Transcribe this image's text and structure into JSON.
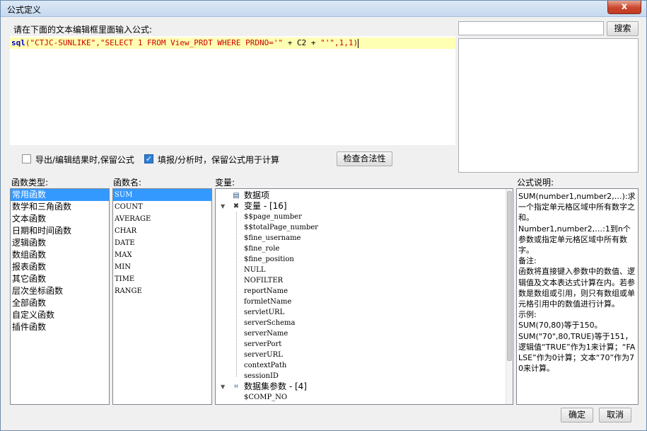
{
  "window": {
    "title": "公式定义",
    "close_label": "x"
  },
  "editor": {
    "label": "请在下面的文本编辑框里面输入公式:",
    "tokens": [
      {
        "text": "sql",
        "kind": "fn"
      },
      {
        "text": "(\"CTJC-SUNLIKE\",\"SELECT 1 FROM View_PRDT WHERE PRDNO='\"",
        "kind": "str"
      },
      {
        "text": " + C2 + ",
        "kind": "plain"
      },
      {
        "text": "\"'\"",
        "kind": "str"
      },
      {
        "text": ",1,1)",
        "kind": "str"
      }
    ]
  },
  "search": {
    "value": "",
    "button_label": "搜索"
  },
  "options": {
    "export_keep": {
      "label": "导出/编辑结果时,保留公式",
      "checked": false
    },
    "fill_keep": {
      "label": "填报/分析时，保留公式用于计算",
      "checked": true
    },
    "check_button": "检查合法性"
  },
  "function_types": {
    "label": "函数类型:",
    "items": [
      "常用函数",
      "数学和三角函数",
      "文本函数",
      "日期和时间函数",
      "逻辑函数",
      "数组函数",
      "报表函数",
      "其它函数",
      "层次坐标函数",
      "全部函数",
      "自定义函数",
      "插件函数"
    ],
    "selected": 0
  },
  "function_names": {
    "label": "函数名:",
    "items": [
      "SUM",
      "COUNT",
      "AVERAGE",
      "CHAR",
      "DATE",
      "MAX",
      "MIN",
      "TIME",
      "RANGE"
    ],
    "selected": 0
  },
  "variables": {
    "label": "变量:",
    "root_data_items": "数据项",
    "group_variables": "变量 - [16]",
    "variable_items": [
      "$$page_number",
      "$$totalPage_number",
      "$fine_username",
      "$fine_role",
      "$fine_position",
      "NULL",
      "NOFILTER",
      "reportName",
      "formletName",
      "servletURL",
      "serverSchema",
      "serverName",
      "serverPort",
      "serverURL",
      "contextPath",
      "sessionID"
    ],
    "group_dataset": "数据集参数 - [4]",
    "dataset_items": [
      "$COMP_NO"
    ]
  },
  "description": {
    "label": "公式说明:",
    "paragraphs": [
      "SUM(number1,number2,…):求一个指定单元格区域中所有数字之和。",
      "Number1,number2,…:1到n个参数或指定单元格区域中所有数字。",
      "备注:",
      "函数将直接键入参数中的数值、逻辑值及文本表达式计算在内。若参数是数组或引用，则只有数组或单元格引用中的数值进行计算。",
      "示例:",
      "SUM(70,80)等于150。",
      "SUM(\"70\",80,TRUE)等于151，逻辑值“TRUE”作为1来计算；“FALSE”作为0计算；文本“70”作为70来计算。"
    ]
  },
  "footer": {
    "ok_label": "确定",
    "cancel_label": "取消"
  }
}
